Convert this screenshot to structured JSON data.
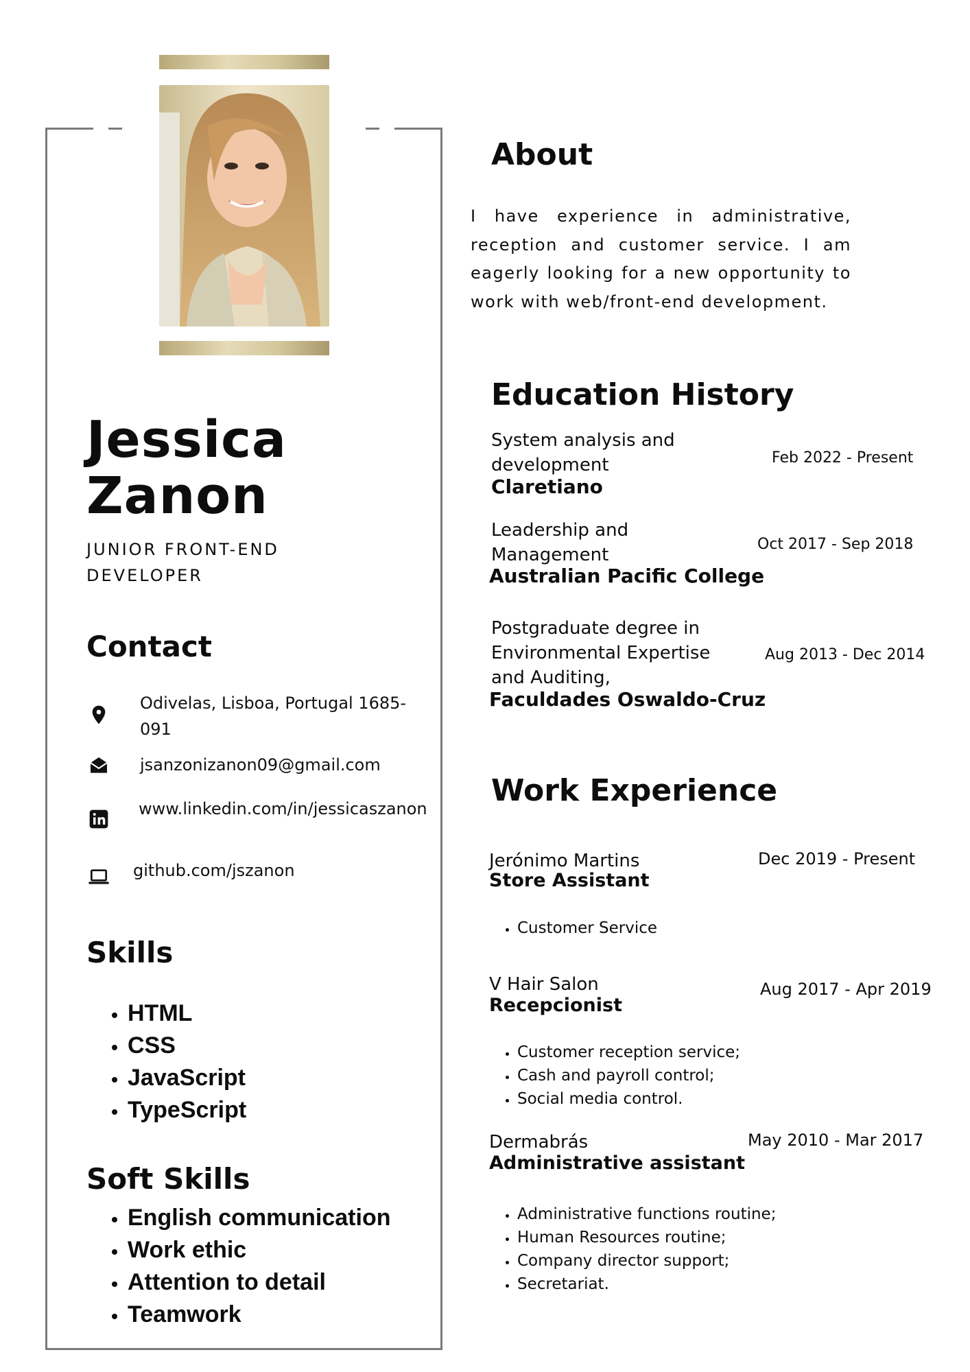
{
  "profile": {
    "first_name": "Jessica",
    "last_name": "Zanon",
    "role": "JUNIOR FRONT-END DEVELOPER"
  },
  "contact": {
    "title": "Contact",
    "items": [
      {
        "icon": "location-pin-icon",
        "text": "Odivelas, Lisboa, Portugal 1685-091"
      },
      {
        "icon": "envelope-icon",
        "text": "jsanzonizanon09@gmail.com"
      },
      {
        "icon": "linkedin-icon",
        "text": "www.linkedin.com/in/jessicaszanon"
      },
      {
        "icon": "laptop-icon",
        "text": "github.com/jszanon"
      }
    ]
  },
  "skills": {
    "title": "Skills",
    "items": [
      "HTML",
      "CSS",
      "JavaScript",
      "TypeScript"
    ]
  },
  "soft_skills": {
    "title": "Soft Skills",
    "items": [
      "English communication",
      "Work ethic",
      "Attention to detail",
      "Teamwork"
    ]
  },
  "about": {
    "title": "About",
    "text": "I have experience in administrative, reception and customer service. I am eagerly looking for a new opportunity to work with web/front-end development."
  },
  "education": {
    "title": "Education History",
    "items": [
      {
        "course": "System analysis and development",
        "school": "Claretiano",
        "dates": "Feb 2022 - Present"
      },
      {
        "course": "Leadership and Management",
        "school": "Australian Pacific College",
        "dates": "Oct 2017 - Sep 2018"
      },
      {
        "course": "Postgraduate degree  in Environmental Expertise and Auditing,",
        "school": "Faculdades Oswaldo-Cruz",
        "dates": "Aug 2013 - Dec 2014"
      }
    ]
  },
  "work": {
    "title": "Work Experience",
    "items": [
      {
        "company": "Jerónimo Martins",
        "position": "Store Assistant",
        "dates": "Dec 2019 - Present",
        "duties": [
          "Customer Service"
        ]
      },
      {
        "company": "V Hair Salon",
        "position": "Recepcionist",
        "dates": "Aug 2017 - Apr 2019",
        "duties": [
          "Customer reception service;",
          "Cash and payroll control;",
          "Social media control."
        ]
      },
      {
        "company": "Dermabrás",
        "position": "Administrative assistant",
        "dates": "May 2010 - Mar 2017",
        "duties": [
          "Administrative functions routine;",
          "Human Resources routine;",
          "Company director support;",
          "Secretariat."
        ]
      }
    ]
  }
}
